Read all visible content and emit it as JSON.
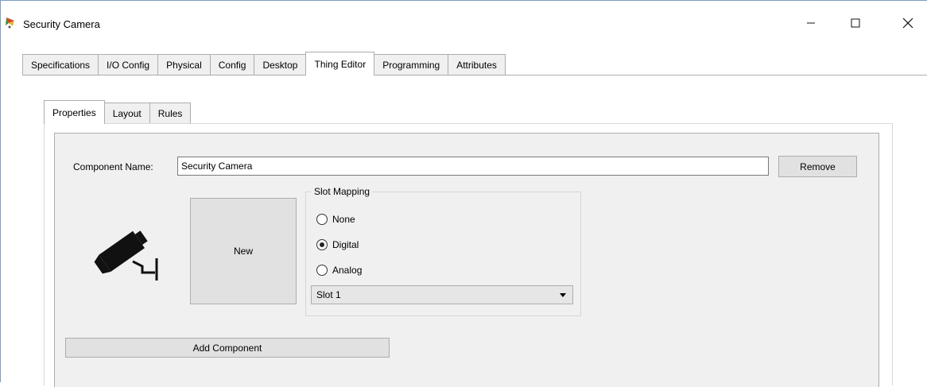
{
  "window": {
    "title": "Security Camera",
    "app_icon": "packet-tracer-icon"
  },
  "outer_tabs": [
    {
      "label": "Specifications",
      "active": false
    },
    {
      "label": "I/O Config",
      "active": false
    },
    {
      "label": "Physical",
      "active": false
    },
    {
      "label": "Config",
      "active": false
    },
    {
      "label": "Desktop",
      "active": false
    },
    {
      "label": "Thing Editor",
      "active": true
    },
    {
      "label": "Programming",
      "active": false
    },
    {
      "label": "Attributes",
      "active": false
    }
  ],
  "inner_tabs": [
    {
      "label": "Properties",
      "active": true
    },
    {
      "label": "Layout",
      "active": false
    },
    {
      "label": "Rules",
      "active": false
    }
  ],
  "component": {
    "name_label": "Component Name:",
    "name_value": "Security Camera",
    "remove_label": "Remove",
    "new_label": "New",
    "add_label": "Add Component",
    "icon": "security-camera-icon"
  },
  "slot_mapping": {
    "legend": "Slot Mapping",
    "options": [
      {
        "label": "None",
        "selected": false
      },
      {
        "label": "Digital",
        "selected": true
      },
      {
        "label": "Analog",
        "selected": false
      }
    ],
    "slot_selected": "Slot 1"
  },
  "colors": {
    "panel_bg": "#f0f0f0",
    "button_bg": "#e1e1e1",
    "border": "#adadad"
  }
}
